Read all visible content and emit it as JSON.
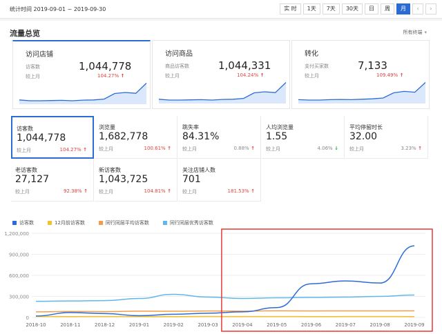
{
  "topbar": {
    "range_label": "统计时间 2019-09-01 ~ 2019-09-30",
    "periods": [
      "实 时",
      "1天",
      "7天",
      "30天",
      "日",
      "周",
      "月"
    ],
    "active_period": "月",
    "prev": "‹",
    "next": "›"
  },
  "panel": {
    "title": "流量总览",
    "filter_label": "所有终端",
    "filter_icon": "chevron-down-icon"
  },
  "cards": [
    {
      "name": "访问店铺",
      "sub": "访客数",
      "value": "1,044,778",
      "compare": "较上月",
      "pct": "104.27%",
      "trend": [
        0.14,
        0.1,
        0.1,
        0.11,
        0.12,
        0.1,
        0.13,
        0.14,
        0.18,
        0.45,
        0.5,
        0.46,
        0.95
      ]
    },
    {
      "name": "访问商品",
      "sub": "商品访客数",
      "value": "1,044,331",
      "compare": "较上月",
      "pct": "104.24%",
      "trend": [
        0.14,
        0.1,
        0.1,
        0.11,
        0.12,
        0.1,
        0.13,
        0.14,
        0.18,
        0.45,
        0.5,
        0.46,
        0.95
      ]
    },
    {
      "name": "转化",
      "sub": "支付买家数",
      "value": "7,133",
      "compare": "较上月",
      "pct": "109.49%",
      "trend": [
        0.12,
        0.1,
        0.1,
        0.12,
        0.13,
        0.12,
        0.14,
        0.16,
        0.2,
        0.45,
        0.52,
        0.48,
        0.95
      ]
    }
  ],
  "metrics": [
    {
      "label": "访客数",
      "value": "1,044,778",
      "compare": "较上月",
      "pct": "104.27%",
      "dir": "up"
    },
    {
      "label": "浏览量",
      "value": "1,682,778",
      "compare": "较上月",
      "pct": "100.61%",
      "dir": "up"
    },
    {
      "label": "跳失率",
      "value": "84.31%",
      "compare": "较上月",
      "pct": "0.88%",
      "dir": "up"
    },
    {
      "label": "人均浏览量",
      "value": "1.55",
      "compare": "较上月",
      "pct": "4.06%",
      "dir": "down"
    },
    {
      "label": "平均停留时长",
      "value": "32.00",
      "compare": "较上月",
      "pct": "3.23%",
      "dir": "up"
    },
    {
      "label": "老访客数",
      "value": "27,127",
      "compare": "较上月",
      "pct": "92.38%",
      "dir": "up"
    },
    {
      "label": "新访客数",
      "value": "1,043,725",
      "compare": "较上月",
      "pct": "104.81%",
      "dir": "up"
    },
    {
      "label": "关注店铺人数",
      "value": "701",
      "compare": "较上月",
      "pct": "181.53%",
      "dir": "up"
    }
  ],
  "legend": [
    {
      "name": "访客数",
      "color": "#2b6cd4"
    },
    {
      "name": "12月前访客数",
      "color": "#f2c12e"
    },
    {
      "name": "同行同层平均访客数",
      "color": "#f39c4a"
    },
    {
      "name": "同行同层优秀访客数",
      "color": "#5fb7ec"
    }
  ],
  "colors": {
    "accent": "#2b6cd4",
    "up": "#e04040",
    "down": "#23a84a",
    "highlight_box": "#e53935"
  },
  "chart_data": {
    "type": "line",
    "x": [
      "2018-10",
      "2018-11",
      "2018-12",
      "2019-01",
      "2019-02",
      "2019-03",
      "2019-04",
      "2019-05",
      "2019-06",
      "2019-07",
      "2019-08",
      "2019-09"
    ],
    "ylim": [
      0,
      1200000
    ],
    "yticks": [
      "1,200,000",
      "900,000",
      "600,000",
      "300,000",
      "0"
    ],
    "series": [
      {
        "name": "访客数",
        "color": "#2b6cd4",
        "values": [
          20000,
          70000,
          55000,
          25000,
          45000,
          60000,
          80000,
          140000,
          480000,
          520000,
          490000,
          1020000
        ]
      },
      {
        "name": "12月前访客数",
        "color": "#f2c12e",
        "values": [
          15000,
          12000,
          14000,
          13000,
          12000,
          15000,
          13000,
          14000,
          12000,
          13000,
          14000,
          12000
        ]
      },
      {
        "name": "同行同层平均访客数",
        "color": "#f39c4a",
        "values": [
          80000,
          85000,
          82000,
          90000,
          88000,
          92000,
          90000,
          95000,
          92000,
          94000,
          93000,
          95000
        ]
      },
      {
        "name": "同行同层优秀访客数",
        "color": "#5fb7ec",
        "values": [
          230000,
          235000,
          240000,
          270000,
          330000,
          290000,
          270000,
          280000,
          285000,
          290000,
          300000,
          320000
        ]
      }
    ],
    "highlight": {
      "from": "2019-04",
      "to": "2019-09"
    }
  }
}
